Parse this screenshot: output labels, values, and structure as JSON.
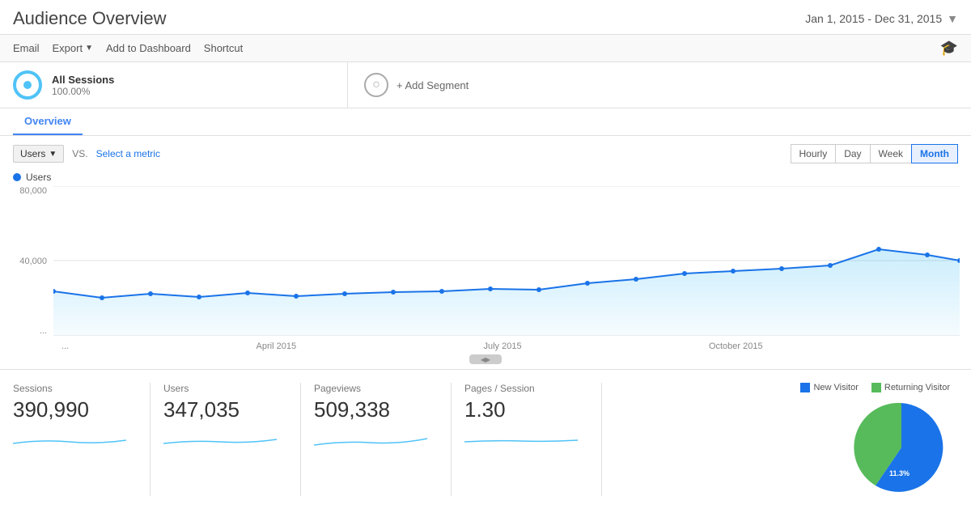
{
  "header": {
    "title": "Audience Overview",
    "dateRange": "Jan 1, 2015 - Dec 31, 2015"
  },
  "toolbar": {
    "email": "Email",
    "export": "Export",
    "addDashboard": "Add to Dashboard",
    "shortcut": "Shortcut"
  },
  "segment": {
    "allSessions": "All Sessions",
    "percentage": "100.00%",
    "addSegment": "+ Add Segment"
  },
  "tab": {
    "overview": "Overview"
  },
  "chart": {
    "metric": "Users",
    "vs": "VS.",
    "selectMetric": "Select a metric",
    "yLabels": [
      "80,000",
      "40,000",
      "..."
    ],
    "xLabels": [
      "...",
      "April 2015",
      "July 2015",
      "October 2015"
    ],
    "legendLabel": "Users",
    "timeBtns": [
      "Hourly",
      "Day",
      "Week",
      "Month"
    ]
  },
  "stats": [
    {
      "label": "Sessions",
      "value": "390,990"
    },
    {
      "label": "Users",
      "value": "347,035"
    },
    {
      "label": "Pageviews",
      "value": "509,338"
    },
    {
      "label": "Pages / Session",
      "value": "1.30"
    }
  ],
  "pie": {
    "newVisitor": "New Visitor",
    "returningVisitor": "Returning Visitor",
    "returningPct": "11.3%",
    "newColor": "#1a73e8",
    "returningColor": "#57bb5b"
  }
}
